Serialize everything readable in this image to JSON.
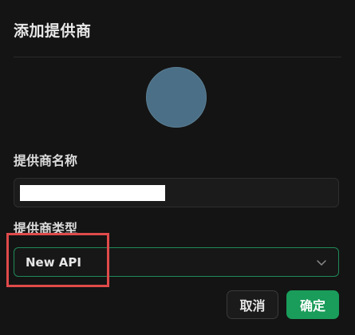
{
  "dialog": {
    "title": "添加提供商"
  },
  "form": {
    "name_label": "提供商名称",
    "name_value": "",
    "type_label": "提供商类型",
    "type_selected": "New API"
  },
  "buttons": {
    "cancel_label": "取消",
    "confirm_label": "确定"
  },
  "colors": {
    "accent": "#1a9c5a",
    "avatar": "#4a6f86",
    "highlight_box": "#e04a4a"
  },
  "icons": {
    "select_chevron": "chevron-down-icon"
  }
}
